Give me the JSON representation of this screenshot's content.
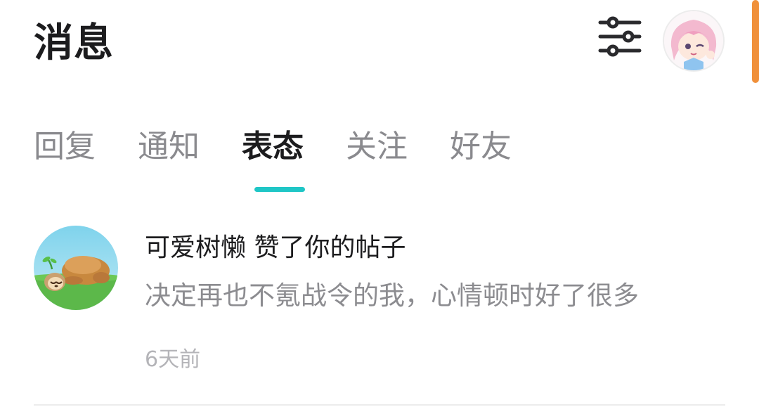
{
  "header": {
    "title": "消息",
    "filter_icon": "sliders-icon",
    "avatar_icon": "user-avatar-icon"
  },
  "tabs": [
    {
      "label": "回复",
      "active": false
    },
    {
      "label": "通知",
      "active": false
    },
    {
      "label": "表态",
      "active": true
    },
    {
      "label": "关注",
      "active": false
    },
    {
      "label": "好友",
      "active": false
    }
  ],
  "notifications": [
    {
      "user": "可爱树懒",
      "action": "赞了你的帖子",
      "post_excerpt": "决定再也不氪战令的我，心情顿时好了很多",
      "time": "6天前",
      "avatar_icon": "sloth-avatar-icon"
    }
  ],
  "colors": {
    "accent": "#1fc6c6",
    "scroll_indicator": "#f0903a",
    "text_primary": "#1c1c1e",
    "text_secondary": "#8c8c90"
  }
}
